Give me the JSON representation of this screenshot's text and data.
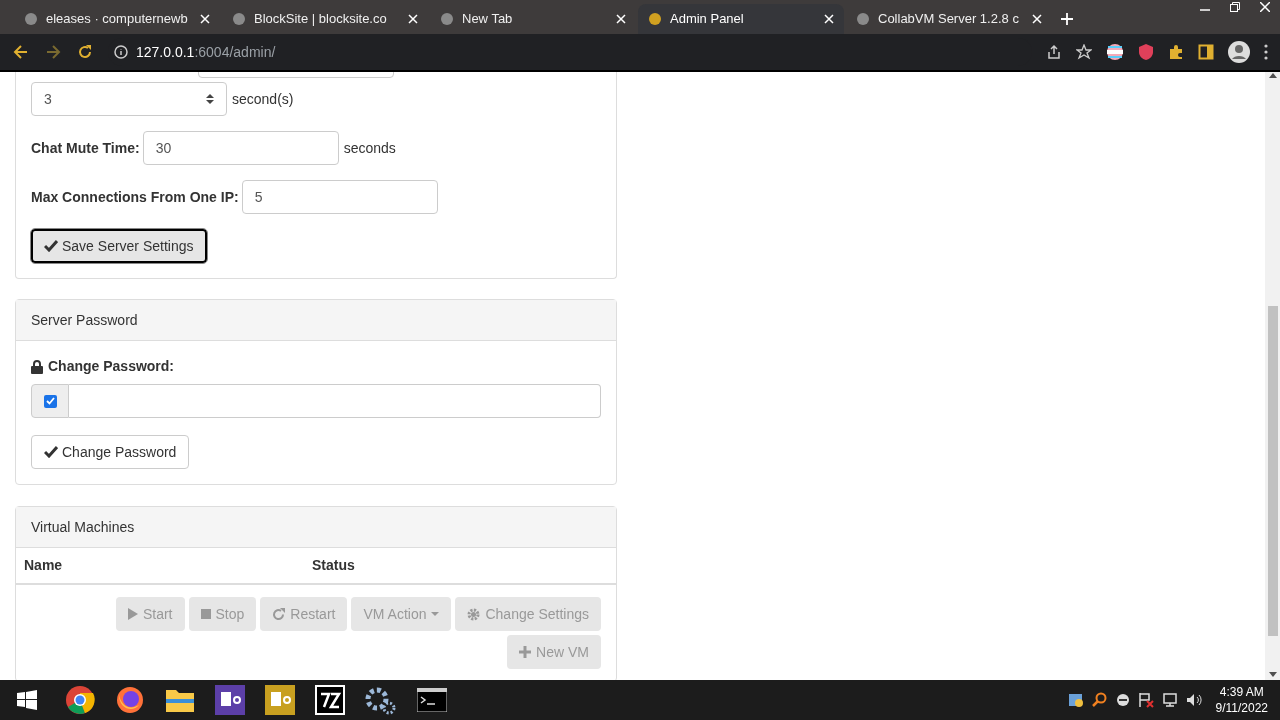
{
  "browser": {
    "tabs": [
      {
        "title": "eleases · computernewb",
        "selected": false
      },
      {
        "title": "BlockSite | blocksite.co",
        "selected": false
      },
      {
        "title": "New Tab",
        "selected": false
      },
      {
        "title": "Admin Panel",
        "selected": true
      },
      {
        "title": "CollabVM Server 1.2.8 c",
        "selected": false
      }
    ],
    "url_host": "127.0.0.1",
    "url_rest": ":6004/admin/"
  },
  "server_settings": {
    "fields": [
      {
        "value": "3",
        "suffix": "second(s)",
        "kind": "spinner"
      },
      {
        "label": "Chat Mute Time:",
        "value": "30",
        "suffix": "seconds",
        "kind": "text"
      },
      {
        "label": "Max Connections From One IP:",
        "value": "5",
        "kind": "text"
      }
    ],
    "save_button": {
      "label": "Save Server Settings",
      "focused": true
    }
  },
  "server_password": {
    "title": "Server Password",
    "label": "Change Password:",
    "checked": true,
    "button": "Change Password"
  },
  "virtual_machines": {
    "title": "Virtual Machines",
    "columns": [
      "Name",
      "Status"
    ],
    "buttons": [
      {
        "label": "Start",
        "kind": "start",
        "disabled": true
      },
      {
        "label": "Stop",
        "kind": "stop",
        "disabled": true
      },
      {
        "label": "Restart",
        "kind": "restart",
        "disabled": true
      },
      {
        "label": "VM Action",
        "kind": "dropdown",
        "disabled": true
      },
      {
        "label": "Change Settings",
        "kind": "settings",
        "disabled": true
      },
      {
        "label": "New VM",
        "kind": "add",
        "disabled": true
      }
    ]
  },
  "taskbar": {
    "time": "4:39 AM",
    "date": "9/11/2022"
  }
}
